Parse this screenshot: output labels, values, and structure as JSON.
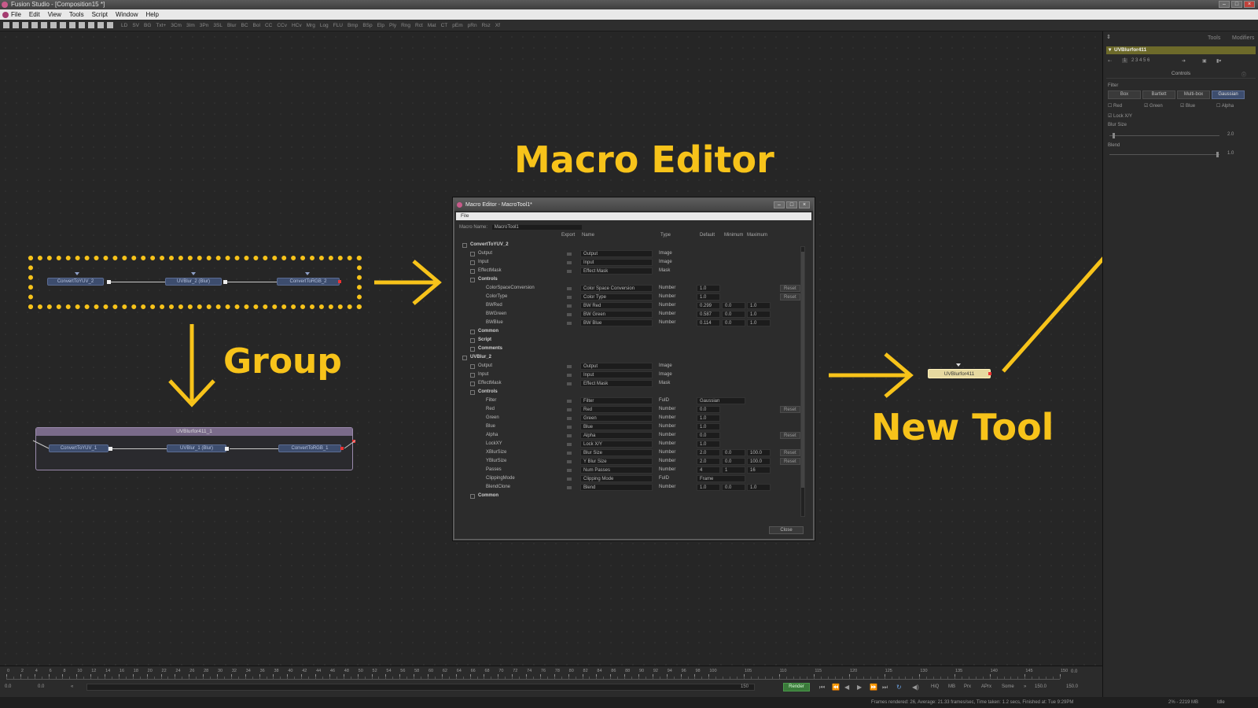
{
  "window": {
    "title": "Fusion Studio - [Composition15 *]"
  },
  "menu": [
    "File",
    "Edit",
    "View",
    "Tools",
    "Script",
    "Window",
    "Help"
  ],
  "toolbar": [
    "LD",
    "SV",
    "BG",
    "Txt+",
    "3Cm",
    "3Im",
    "3Pn",
    "3SL",
    "Blur",
    "BC",
    "Bol",
    "CC",
    "CCv",
    "HCv",
    "Mrg",
    "Log",
    "FLU",
    "Bmp",
    "BSp",
    "Elp",
    "Ply",
    "Rng",
    "Rct",
    "Mat",
    "CT",
    "pEm",
    "pRn",
    "Rsz",
    "Xf"
  ],
  "flow": {
    "selected_nodes": [
      "ConvertToYUV_2",
      "UVBlur_2 (Blur)",
      "ConvertToRGB_2"
    ],
    "group_title": "UVBlurfor411_1",
    "group_nodes": [
      "ConvertToYUV_1",
      "UVBlur_1 (Blur)",
      "ConvertToRGB_1"
    ],
    "new_tool_node": "UVBlurfor411"
  },
  "annotations": {
    "macro_editor": "Macro Editor",
    "group": "Group",
    "new_tool": "New Tool",
    "color": "#f7c31a"
  },
  "macro_editor": {
    "title": "Macro Editor - MacroTool1*",
    "menu": "File",
    "macro_name_label": "Macro Name:",
    "macro_name_value": "MacroTool1",
    "columns": [
      "Export",
      "Name",
      "Type",
      "Default",
      "Minimum",
      "Maximum"
    ],
    "rows": [
      {
        "lvl": 0,
        "label": "ConvertToYUV_2",
        "bold": true
      },
      {
        "lvl": 1,
        "label": "Output",
        "name": "Output",
        "type": "Image"
      },
      {
        "lvl": 1,
        "label": "Input",
        "name": "Input",
        "type": "Image"
      },
      {
        "lvl": 1,
        "label": "EffectMask",
        "name": "Effect Mask",
        "type": "Mask"
      },
      {
        "lvl": 1,
        "label": "Controls",
        "bold": true
      },
      {
        "lvl": 2,
        "label": "ColorSpaceConversion",
        "name": "Color Space Conversion",
        "type": "Number",
        "def": "1.0",
        "reset": "Reset"
      },
      {
        "lvl": 2,
        "label": "ColorType",
        "name": "Color Type",
        "type": "Number",
        "def": "1.0",
        "reset": "Reset"
      },
      {
        "lvl": 2,
        "label": "BWRed",
        "name": "BW Red",
        "type": "Number",
        "def": "0.299",
        "min": "0.0",
        "max": "1.0"
      },
      {
        "lvl": 2,
        "label": "BWGreen",
        "name": "BW Green",
        "type": "Number",
        "def": "0.587",
        "min": "0.0",
        "max": "1.0"
      },
      {
        "lvl": 2,
        "label": "BWBlue",
        "name": "BW Blue",
        "type": "Number",
        "def": "0.114",
        "min": "0.0",
        "max": "1.0"
      },
      {
        "lvl": 1,
        "label": "Common",
        "bold": true
      },
      {
        "lvl": 1,
        "label": "Script",
        "bold": true
      },
      {
        "lvl": 1,
        "label": "Comments",
        "bold": true
      },
      {
        "lvl": 0,
        "label": "UVBlur_2",
        "bold": true
      },
      {
        "lvl": 1,
        "label": "Output",
        "name": "Output",
        "type": "Image"
      },
      {
        "lvl": 1,
        "label": "Input",
        "name": "Input",
        "type": "Image"
      },
      {
        "lvl": 1,
        "label": "EffectMask",
        "name": "Effect Mask",
        "type": "Mask"
      },
      {
        "lvl": 1,
        "label": "Controls",
        "bold": true
      },
      {
        "lvl": 2,
        "label": "Filter",
        "name": "Filter",
        "type": "FuID",
        "def": "Gaussian"
      },
      {
        "lvl": 2,
        "label": "Red",
        "name": "Red",
        "type": "Number",
        "def": "0.0",
        "reset": "Reset"
      },
      {
        "lvl": 2,
        "label": "Green",
        "name": "Green",
        "type": "Number",
        "def": "1.0"
      },
      {
        "lvl": 2,
        "label": "Blue",
        "name": "Blue",
        "type": "Number",
        "def": "1.0"
      },
      {
        "lvl": 2,
        "label": "Alpha",
        "name": "Alpha",
        "type": "Number",
        "def": "0.0",
        "reset": "Reset"
      },
      {
        "lvl": 2,
        "label": "LockXY",
        "name": "Lock X/Y",
        "type": "Number",
        "def": "1.0"
      },
      {
        "lvl": 2,
        "label": "XBlurSize",
        "name": "Blur Size",
        "type": "Number",
        "def": "2.0",
        "min": "0.0",
        "max": "100.0",
        "reset": "Reset"
      },
      {
        "lvl": 2,
        "label": "YBlurSize",
        "name": "Y Blur Size",
        "type": "Number",
        "def": "2.0",
        "min": "0.0",
        "max": "100.0",
        "reset": "Reset"
      },
      {
        "lvl": 2,
        "label": "Passes",
        "name": "Num Passes",
        "type": "Number",
        "def": "4",
        "min": "1",
        "max": "16"
      },
      {
        "lvl": 2,
        "label": "ClippingMode",
        "name": "Clipping Mode",
        "type": "FuID",
        "def": "Frame"
      },
      {
        "lvl": 2,
        "label": "BlendClone",
        "name": "Blend",
        "type": "Number",
        "def": "1.0",
        "min": "0.0",
        "max": "1.0"
      },
      {
        "lvl": 1,
        "label": "Common",
        "bold": true
      }
    ],
    "close_label": "Close"
  },
  "inspector": {
    "tabs": [
      "Tools",
      "Modifiers"
    ],
    "tool_name": "UVBlurfor411",
    "controls_label": "Controls",
    "filter_label": "Filter",
    "filter_options": [
      "Box",
      "Bartlett",
      "Multi-box",
      "Gaussian"
    ],
    "filter_selected": "Gaussian",
    "channels": [
      "Red",
      "Green",
      "Blue",
      "Alpha"
    ],
    "lock_label": "Lock X/Y",
    "blur_size_label": "Blur Size",
    "blur_size_value": "2.0",
    "blend_label": "Blend",
    "blend_value": "1.0"
  },
  "timeline": {
    "ticks": [
      "0",
      "2",
      "4",
      "6",
      "8",
      "10",
      "12",
      "14",
      "16",
      "18",
      "20",
      "22",
      "24",
      "26",
      "28",
      "30",
      "32",
      "34",
      "36",
      "38",
      "40",
      "42",
      "44",
      "46",
      "48",
      "50",
      "52",
      "54",
      "56",
      "58",
      "60",
      "62",
      "64",
      "66",
      "68",
      "70",
      "72",
      "74",
      "76",
      "78",
      "80",
      "82",
      "84",
      "86",
      "88",
      "90",
      "92",
      "94",
      "96",
      "98",
      "100",
      "105",
      "110",
      "115",
      "120",
      "125",
      "130",
      "135",
      "140",
      "145",
      "150"
    ],
    "start": "0.0",
    "current": "0.0",
    "end_field": "150",
    "render_label": "Render",
    "hq": "HiQ",
    "mb": "MB",
    "prx": "Prx",
    "aprx": "APrx",
    "some": "Some",
    "end": "150.0",
    "global_end": "150.0",
    "right_val": "0.0"
  },
  "status": {
    "text": "Frames rendered: 26,  Average: 21.33 frames/sec,  Time taken: 1.2 secs,  Finished at: Tue 9:29PM",
    "mem": "2% - 2219 MB",
    "state": "Idle"
  }
}
